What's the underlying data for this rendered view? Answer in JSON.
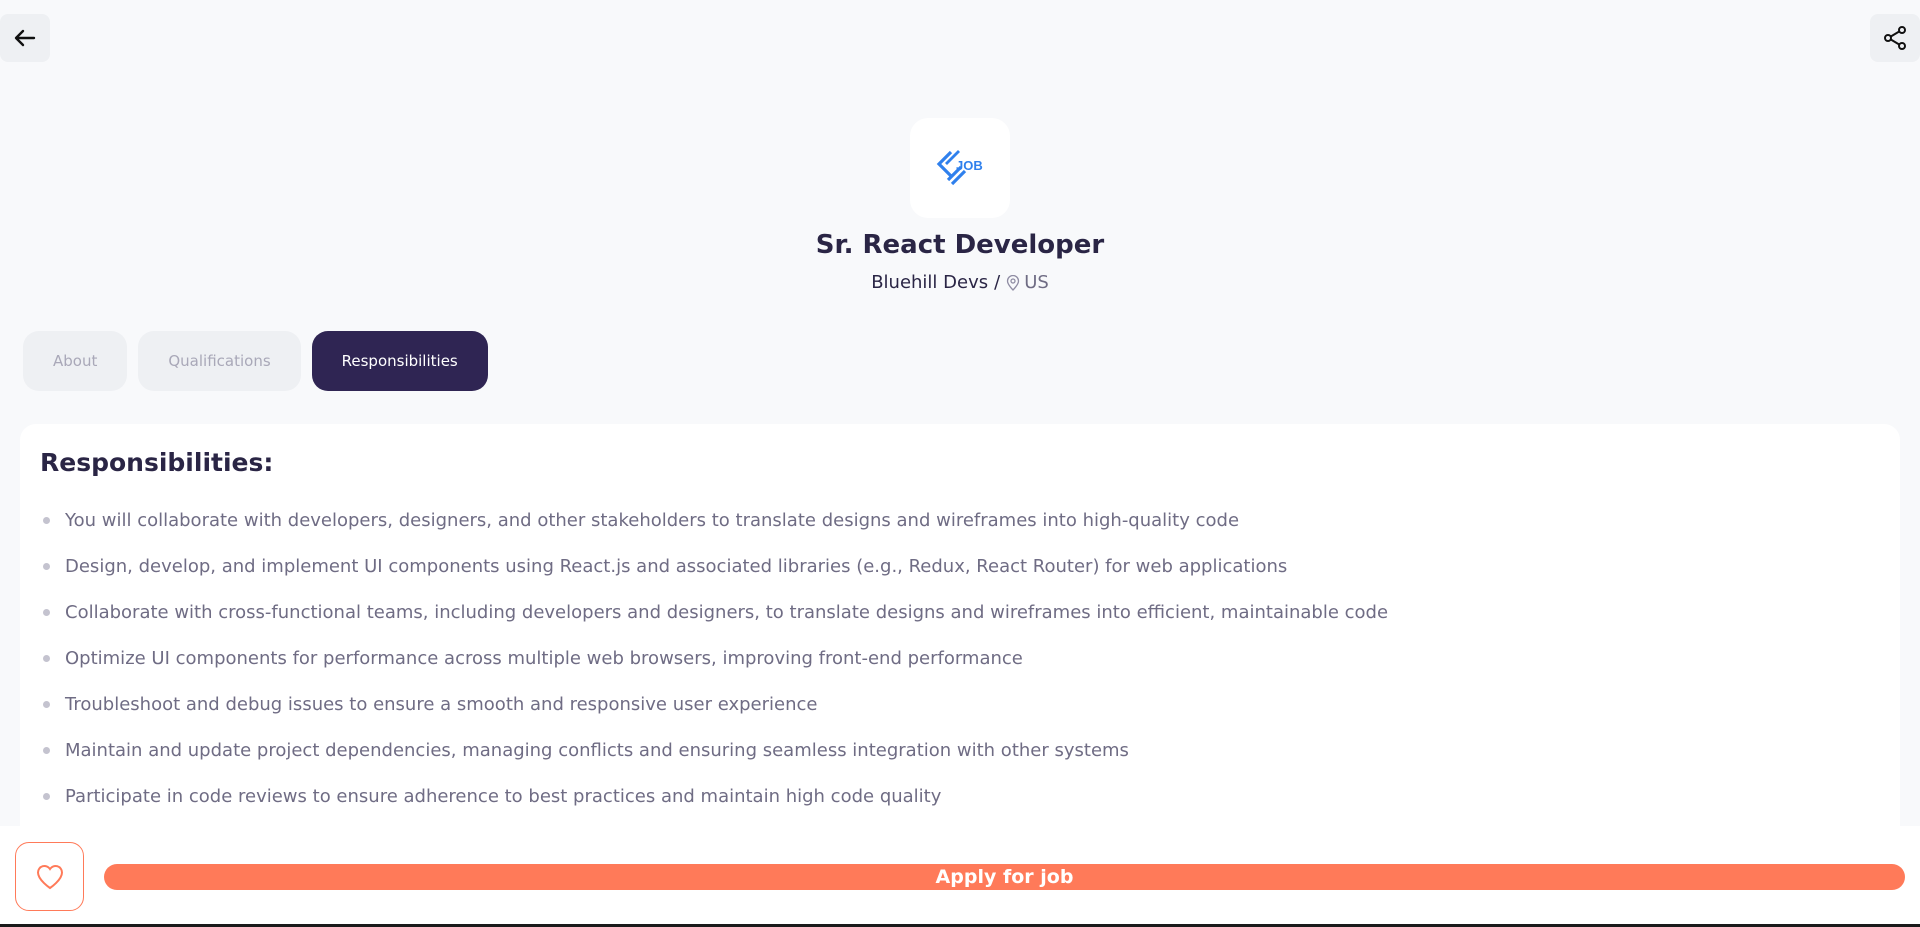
{
  "header": {
    "back_icon": "arrow-left-icon",
    "share_icon": "share-icon"
  },
  "job": {
    "logo_text": "JOB",
    "title": "Sr. React Developer",
    "company": "Bluehill Devs",
    "separator": "/",
    "location": "US",
    "location_icon": "map-pin-icon"
  },
  "tabs": [
    {
      "label": "About",
      "active": false
    },
    {
      "label": "Qualifications",
      "active": false
    },
    {
      "label": "Responsibilities",
      "active": true
    }
  ],
  "content": {
    "heading": "Responsibilities:",
    "items": [
      "You will collaborate with developers, designers, and other stakeholders to translate designs and wireframes into high-quality code",
      "Design, develop, and implement UI components using React.js and associated libraries (e.g., Redux, React Router) for web applications",
      "Collaborate with cross-functional teams, including developers and designers, to translate designs and wireframes into efficient, maintainable code",
      "Optimize UI components for performance across multiple web browsers, improving front-end performance",
      "Troubleshoot and debug issues to ensure a smooth and responsive user experience",
      "Maintain and update project dependencies, managing conflicts and ensuring seamless integration with other systems",
      "Participate in code reviews to ensure adherence to best practices and maintain high code quality"
    ]
  },
  "footer": {
    "favorite_icon": "heart-icon",
    "apply_label": "Apply for job"
  },
  "colors": {
    "accent": "#ff7a59",
    "primary_dark": "#2f2553",
    "logo_blue": "#2f80ed",
    "background": "#f8f9fb"
  }
}
